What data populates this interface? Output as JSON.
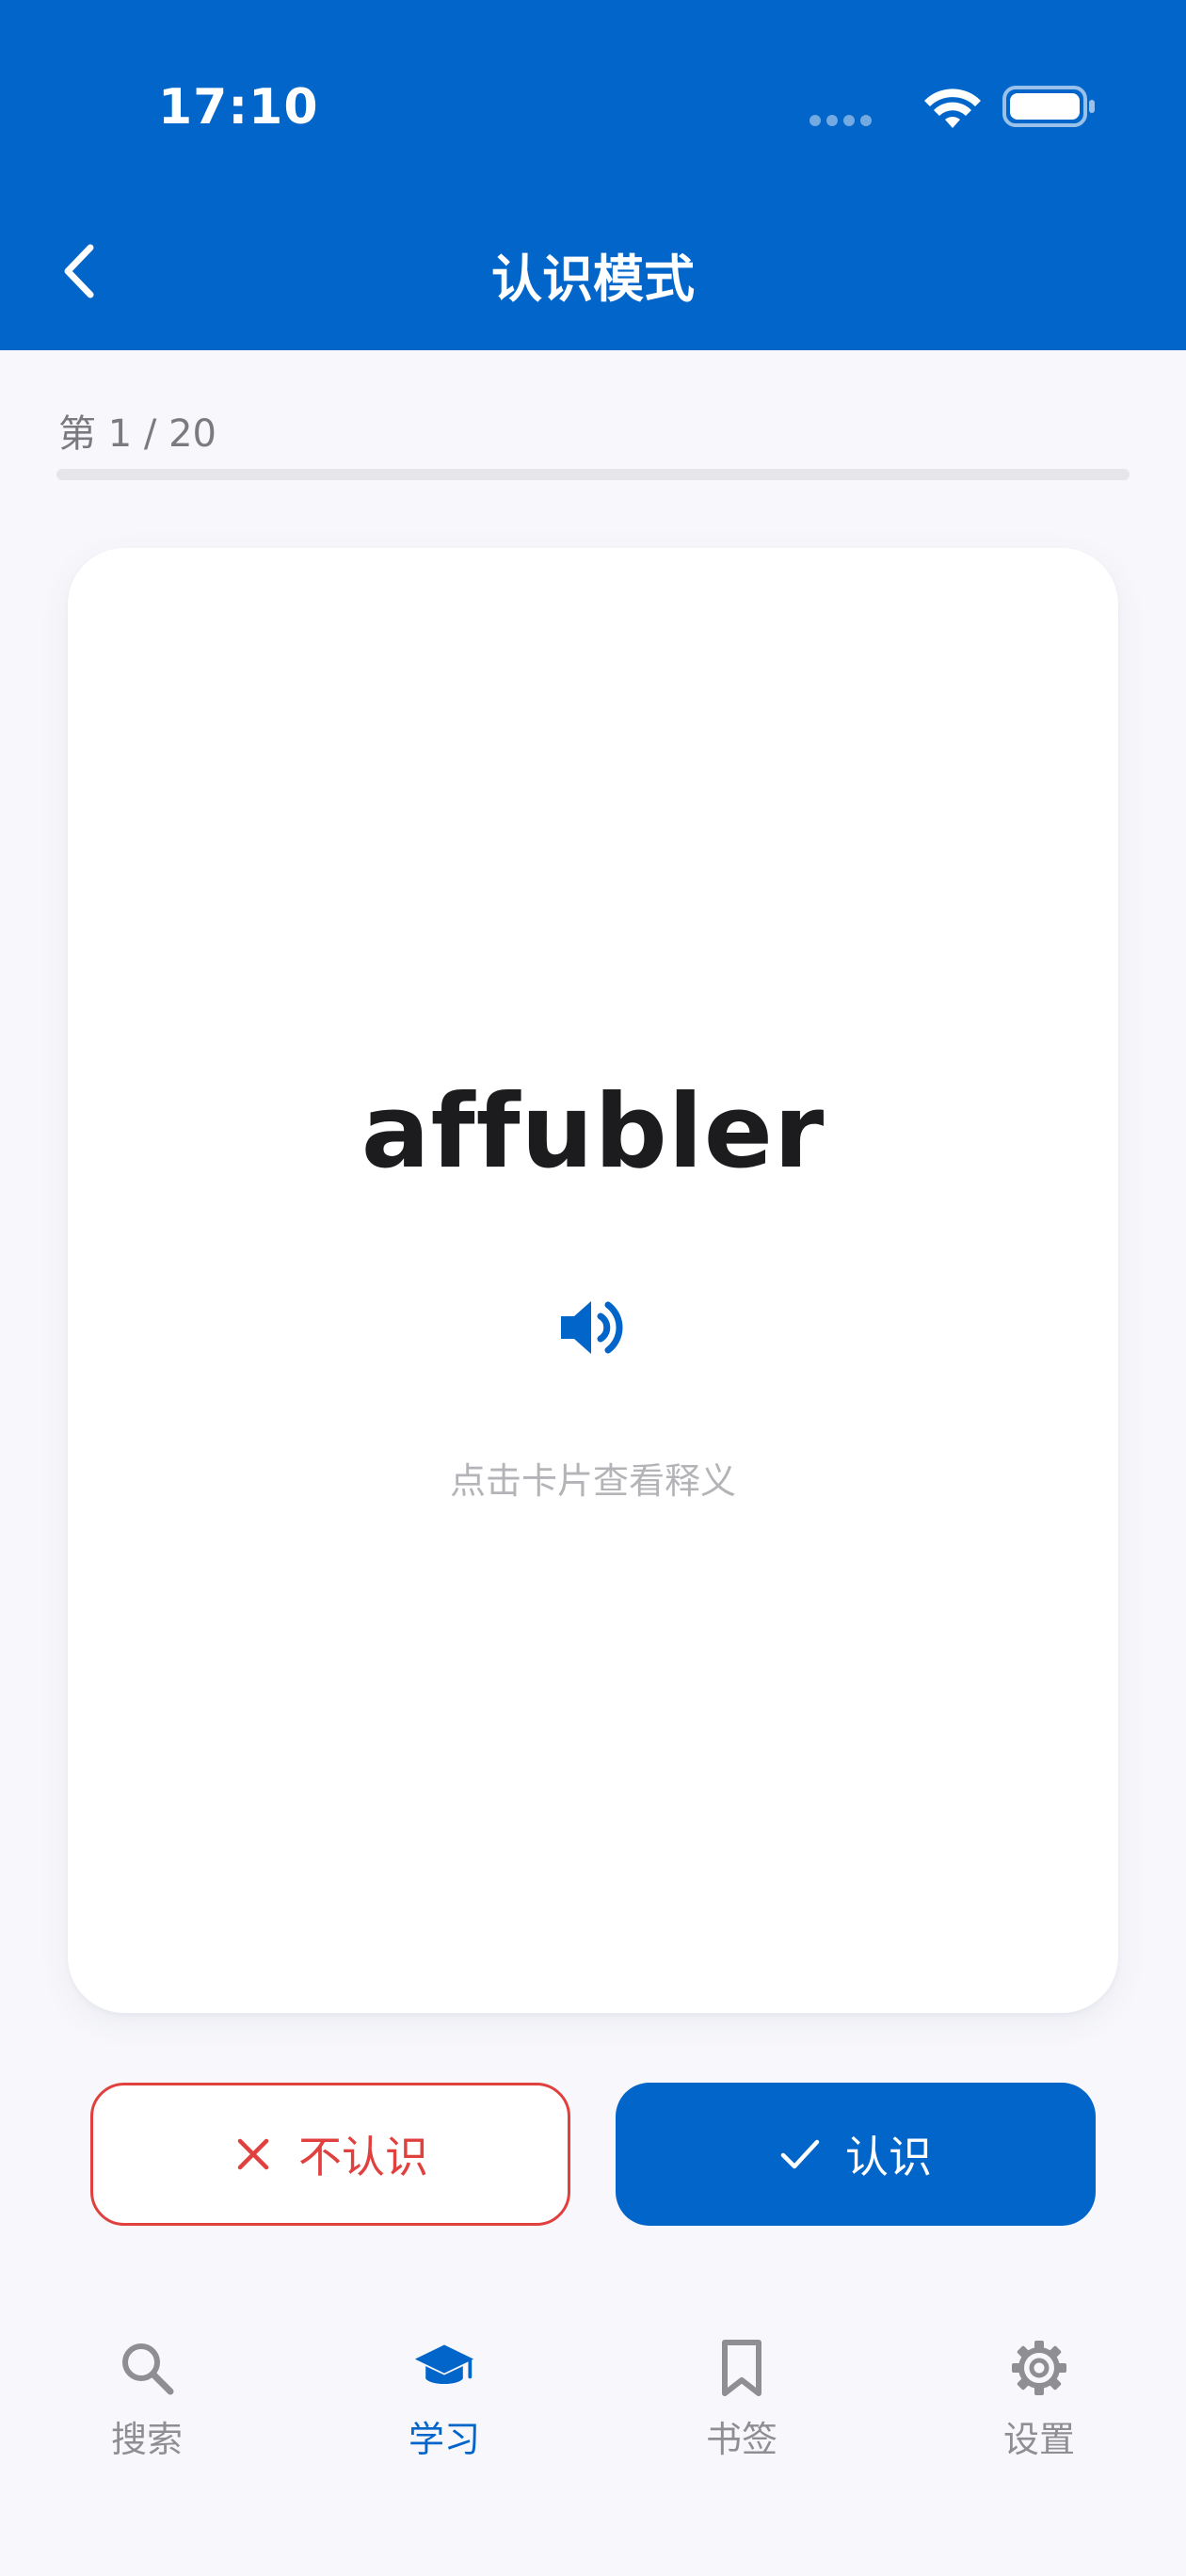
{
  "status_bar": {
    "time": "17:10"
  },
  "nav": {
    "title": "认识模式",
    "back_icon": "chevron-left-icon"
  },
  "progress": {
    "text": "第 1 / 20",
    "current": 1,
    "total": 20,
    "fraction": 0
  },
  "card": {
    "word": "affubler",
    "speaker_icon": "speaker-icon",
    "hint": "点击卡片查看释义"
  },
  "actions": {
    "unknown_label": "不认识",
    "unknown_icon": "close-icon",
    "known_label": "认识",
    "known_icon": "check-icon"
  },
  "tabs": [
    {
      "label": "搜索",
      "icon": "search-icon",
      "active": false
    },
    {
      "label": "学习",
      "icon": "graduation-cap-icon",
      "active": true
    },
    {
      "label": "书签",
      "icon": "bookmark-icon",
      "active": false
    },
    {
      "label": "设置",
      "icon": "gear-icon",
      "active": false
    }
  ],
  "colors": {
    "primary": "#0165c9",
    "danger": "#e0413e",
    "background": "#f8f8fc",
    "inactive": "#8e8e93"
  }
}
